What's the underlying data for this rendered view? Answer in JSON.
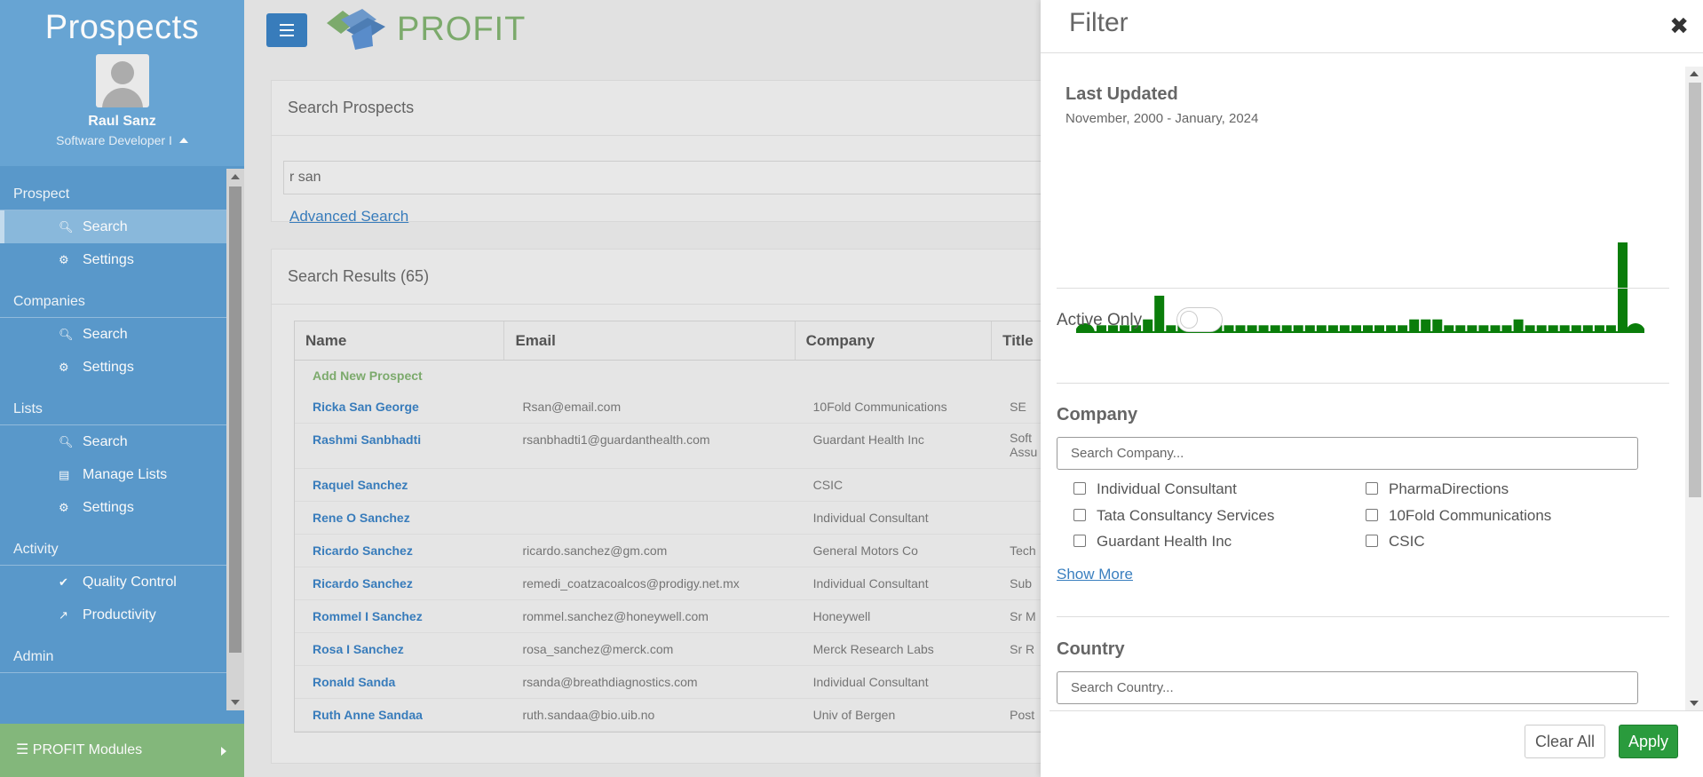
{
  "sidebar": {
    "app_title": "Prospects",
    "user_name": "Raul Sanz",
    "user_role": "Software Developer I",
    "sections": [
      {
        "title": "Prospect",
        "items": [
          {
            "label": "Search",
            "icon": "search-icon"
          },
          {
            "label": "Settings",
            "icon": "gear-icon"
          }
        ]
      },
      {
        "title": "Companies",
        "items": [
          {
            "label": "Search",
            "icon": "search-icon"
          },
          {
            "label": "Settings",
            "icon": "gear-icon"
          }
        ]
      },
      {
        "title": "Lists",
        "items": [
          {
            "label": "Search",
            "icon": "search-icon"
          },
          {
            "label": "Manage Lists",
            "icon": "inbox-icon"
          },
          {
            "label": "Settings",
            "icon": "gear-icon"
          }
        ]
      },
      {
        "title": "Activity",
        "items": [
          {
            "label": "Quality Control",
            "icon": "check-circle-icon"
          },
          {
            "label": "Productivity",
            "icon": "line-chart-icon"
          }
        ]
      },
      {
        "title": "Admin",
        "items": []
      }
    ],
    "modules_label": "PROFIT Modules"
  },
  "header": {
    "logo_text": "PROFIT"
  },
  "search": {
    "panel_title": "Search Prospects",
    "query": "r san",
    "advanced_link": "Advanced Search"
  },
  "results": {
    "title": "Search Results (65)",
    "columns": [
      "Name",
      "Email",
      "Company",
      "Title"
    ],
    "add_new": "Add New Prospect",
    "rows": [
      {
        "name": "Ricka San George",
        "email": "Rsan@email.com",
        "company": "10Fold Communications",
        "title": "SE"
      },
      {
        "name": "Rashmi Sanbhadti",
        "email": "rsanbhadti1@guardanthealth.com",
        "company": "Guardant Health Inc",
        "title": "Soft",
        "title2": "Assu"
      },
      {
        "name": "Raquel Sanchez",
        "email": "",
        "company": "CSIC",
        "title": ""
      },
      {
        "name": "Rene O Sanchez",
        "email": "",
        "company": "Individual Consultant",
        "title": ""
      },
      {
        "name": "Ricardo Sanchez",
        "email": "ricardo.sanchez@gm.com",
        "company": "General Motors Co",
        "title": "Tech"
      },
      {
        "name": "Ricardo Sanchez",
        "email": "remedi_coatzacoalcos@prodigy.net.mx",
        "company": "Individual Consultant",
        "title": "Sub"
      },
      {
        "name": "Rommel I Sanchez",
        "email": "rommel.sanchez@honeywell.com",
        "company": "Honeywell",
        "title": "Sr M"
      },
      {
        "name": "Rosa I Sanchez",
        "email": "rosa_sanchez@merck.com",
        "company": "Merck Research Labs",
        "title": "Sr R"
      },
      {
        "name": "Ronald Sanda",
        "email": "rsanda@breathdiagnostics.com",
        "company": "Individual Consultant",
        "title": ""
      },
      {
        "name": "Ruth Anne Sandaa",
        "email": "ruth.sandaa@bio.uib.no",
        "company": "Univ of Bergen",
        "title": "Post"
      }
    ]
  },
  "filter": {
    "title": "Filter",
    "last_updated_title": "Last Updated",
    "last_updated_range": "November, 2000 - January, 2024",
    "histogram_color": "#0a7d0a",
    "histogram_values": [
      1,
      1,
      1,
      1,
      2,
      6,
      1,
      1,
      2,
      1,
      1,
      1,
      1,
      1,
      1,
      1,
      1,
      1,
      1,
      1,
      1,
      1,
      1,
      1,
      1,
      1,
      1,
      2,
      2,
      2,
      1,
      1,
      1,
      1,
      1,
      1,
      2,
      1,
      1,
      1,
      1,
      1,
      1,
      1,
      1,
      15
    ],
    "active_only_label": "Active Only",
    "active_only_value": false,
    "company_title": "Company",
    "company_search_placeholder": "Search Company...",
    "company_options": [
      "Individual Consultant",
      "PharmaDirections",
      "Tata Consultancy Services",
      "10Fold Communications",
      "Guardant Health Inc",
      "CSIC"
    ],
    "show_more": "Show More",
    "country_title": "Country",
    "country_search_placeholder": "Search Country...",
    "clear_label": "Clear All",
    "apply_label": "Apply"
  }
}
